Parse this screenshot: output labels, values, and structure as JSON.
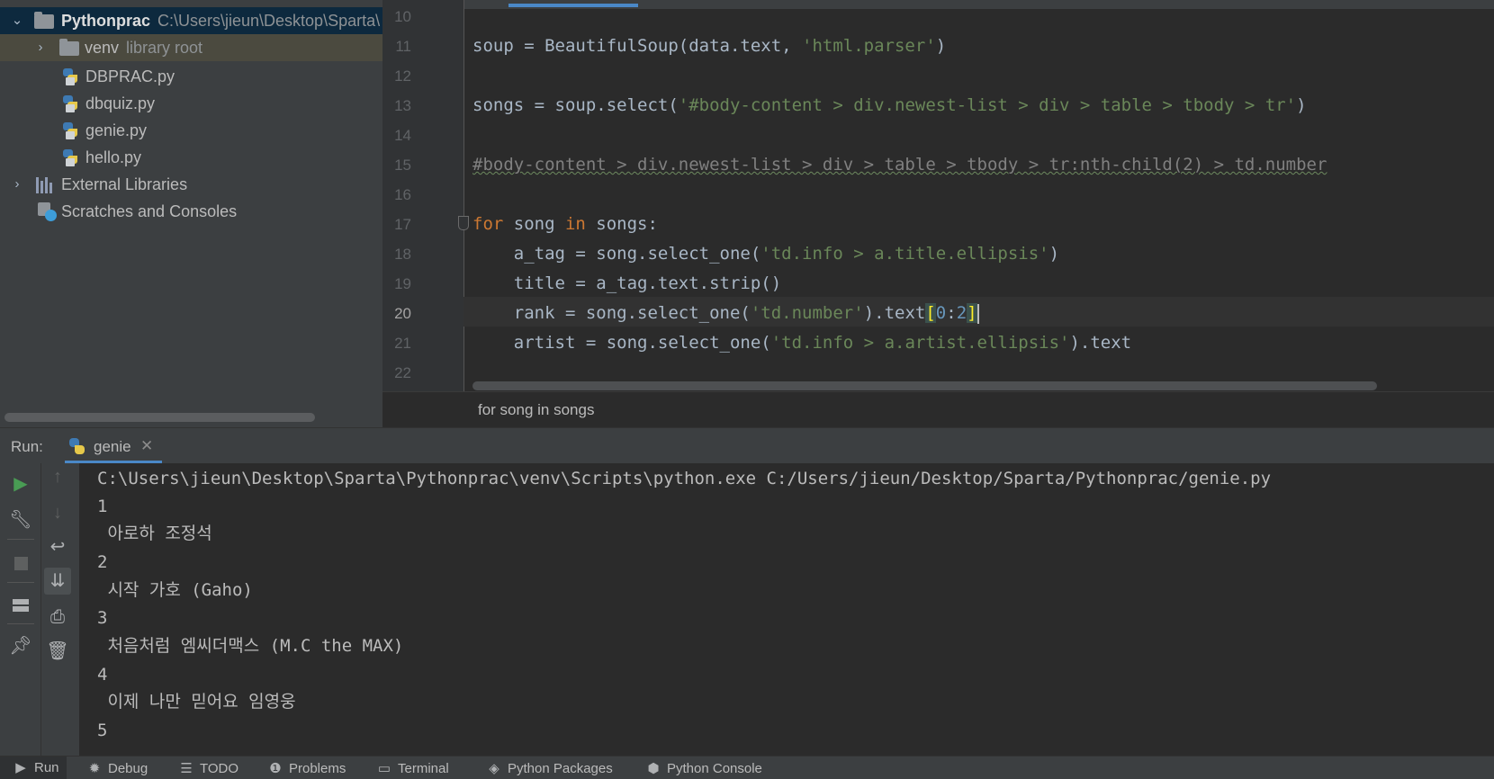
{
  "project_tree": {
    "root": {
      "name": "Pythonprac",
      "path": "C:\\Users\\jieun\\Desktop\\Sparta\\"
    },
    "venv": {
      "name": "venv",
      "note": "library root"
    },
    "files": [
      "DBPRAC.py",
      "dbquiz.py",
      "genie.py",
      "hello.py"
    ],
    "external_libraries": "External Libraries",
    "scratches": "Scratches and Consoles"
  },
  "editor": {
    "line_numbers": [
      "10",
      "11",
      "12",
      "13",
      "14",
      "15",
      "16",
      "17",
      "18",
      "19",
      "20",
      "21",
      "22"
    ],
    "current_line": "20",
    "code": {
      "l11_a": "soup = BeautifulSoup(data.text, ",
      "l11_s": "'html.parser'",
      "l11_b": ")",
      "l13_a": "songs = soup.select(",
      "l13_s": "'#body-content > div.newest-list > div > table > tbody > tr'",
      "l13_b": ")",
      "l15": "#body-content > div.newest-list > div > table > tbody > tr:nth-child(2) > td.number",
      "l17_kw1": "for",
      "l17_a": " song ",
      "l17_kw2": "in",
      "l17_b": " songs:",
      "l18_a": "    a_tag = song.select_one(",
      "l18_s": "'td.info > a.title.ellipsis'",
      "l18_b": ")",
      "l19": "    title = a_tag.text.strip()",
      "l20_a": "    rank = song.select_one(",
      "l20_s": "'td.number'",
      "l20_b": ").text",
      "l20_br1": "[",
      "l20_n1": "0",
      "l20_colon": ":",
      "l20_n2": "2",
      "l20_br2": "]",
      "l21_a": "    artist = song.select_one(",
      "l21_s": "'td.info > a.artist.ellipsis'",
      "l21_b": ").text"
    },
    "breadcrumb": "for song in songs"
  },
  "run_panel": {
    "label": "Run:",
    "tab": "genie",
    "close_glyph": "✕",
    "command": "C:\\Users\\jieun\\Desktop\\Sparta\\Pythonprac\\venv\\Scripts\\python.exe C:/Users/jieun/Desktop/Sparta/Pythonprac/genie.py",
    "output": [
      "1",
      " 아로하 조정석",
      "2",
      " 시작 가호 (Gaho)",
      "3",
      " 처음처럼 엠씨더맥스 (M.C the MAX)",
      "4",
      " 이제 나만 믿어요 임영웅",
      "5"
    ]
  },
  "bottom_bar": {
    "tabs": [
      "Run",
      "Debug",
      "TODO",
      "Problems",
      "Terminal",
      "Python Packages",
      "Python Console"
    ]
  },
  "colors": {
    "keyword": "#cc7832",
    "string": "#6a8759",
    "number": "#6897bb",
    "accent": "#4a88c7",
    "run_green": "#499c54"
  }
}
